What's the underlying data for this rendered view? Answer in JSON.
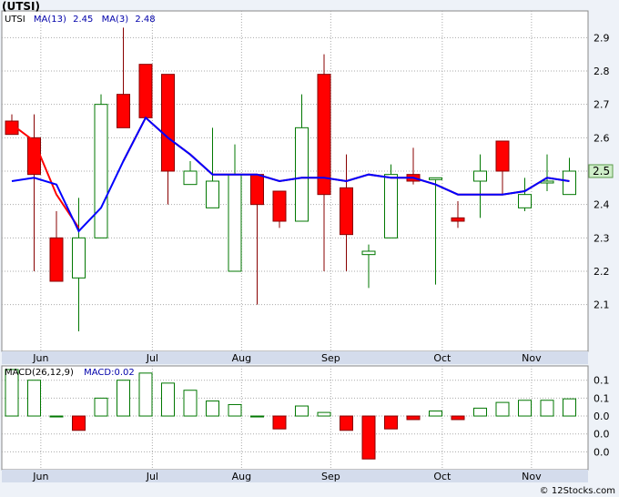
{
  "title": "(UTSI)",
  "watermark": "© 12Stocks.com",
  "colors": {
    "up_border": "#007700",
    "down_fill": "#ff0000",
    "ma13": "#ff0000",
    "ma3": "#0000ff",
    "grid": "#aaaaaa",
    "pane_bg": "#ffffff",
    "axis_bg": "#d4dcec",
    "price_highlight": "#cfeec9",
    "macd_label": "#0000aa"
  },
  "months": [
    {
      "label": "Jun",
      "x": 1.3
    },
    {
      "label": "Jul",
      "x": 6.3
    },
    {
      "label": "Aug",
      "x": 10.3
    },
    {
      "label": "Sep",
      "x": 14.3
    },
    {
      "label": "Oct",
      "x": 19.3
    },
    {
      "label": "Nov",
      "x": 23.3
    }
  ],
  "chart_data": [
    {
      "type": "candlestick",
      "legend": {
        "symbol": "UTSI",
        "ma13_label": "MA(13)",
        "ma13_value": "2.45",
        "ma3_label": "MA(3)",
        "ma3_value": "2.48"
      },
      "ylim": [
        1.96,
        2.98
      ],
      "yticks": [
        2.1,
        2.2,
        2.3,
        2.4,
        2.5,
        2.6,
        2.7,
        2.8,
        2.9
      ],
      "last_price": "2.5",
      "candles": [
        {
          "o": 2.65,
          "h": 2.67,
          "l": 2.61,
          "c": 2.61
        },
        {
          "o": 2.6,
          "h": 2.67,
          "l": 2.2,
          "c": 2.49
        },
        {
          "o": 2.3,
          "h": 2.38,
          "l": 2.17,
          "c": 2.17
        },
        {
          "o": 2.18,
          "h": 2.42,
          "l": 2.02,
          "c": 2.3
        },
        {
          "o": 2.3,
          "h": 2.73,
          "l": 2.3,
          "c": 2.7
        },
        {
          "o": 2.73,
          "h": 2.93,
          "l": 2.63,
          "c": 2.63
        },
        {
          "o": 2.82,
          "h": 2.82,
          "l": 2.66,
          "c": 2.66
        },
        {
          "o": 2.79,
          "h": 2.79,
          "l": 2.4,
          "c": 2.5
        },
        {
          "o": 2.46,
          "h": 2.53,
          "l": 2.46,
          "c": 2.5
        },
        {
          "o": 2.39,
          "h": 2.63,
          "l": 2.39,
          "c": 2.47
        },
        {
          "o": 2.2,
          "h": 2.58,
          "l": 2.2,
          "c": 2.49
        },
        {
          "o": 2.49,
          "h": 2.49,
          "l": 2.1,
          "c": 2.4
        },
        {
          "o": 2.44,
          "h": 2.44,
          "l": 2.33,
          "c": 2.35
        },
        {
          "o": 2.35,
          "h": 2.73,
          "l": 2.35,
          "c": 2.63
        },
        {
          "o": 2.79,
          "h": 2.85,
          "l": 2.2,
          "c": 2.43
        },
        {
          "o": 2.45,
          "h": 2.55,
          "l": 2.2,
          "c": 2.31
        },
        {
          "o": 2.25,
          "h": 2.28,
          "l": 2.15,
          "c": 2.26
        },
        {
          "o": 2.3,
          "h": 2.52,
          "l": 2.3,
          "c": 2.49
        },
        {
          "o": 2.49,
          "h": 2.57,
          "l": 2.46,
          "c": 2.47
        },
        {
          "o": 2.48,
          "h": 2.48,
          "l": 2.16,
          "c": 2.48
        },
        {
          "o": 2.36,
          "h": 2.41,
          "l": 2.33,
          "c": 2.35
        },
        {
          "o": 2.47,
          "h": 2.55,
          "l": 2.36,
          "c": 2.5
        },
        {
          "o": 2.59,
          "h": 2.59,
          "l": 2.43,
          "c": 2.5
        },
        {
          "o": 2.39,
          "h": 2.48,
          "l": 2.38,
          "c": 2.43
        },
        {
          "o": 2.47,
          "h": 2.55,
          "l": 2.44,
          "c": 2.47
        },
        {
          "o": 2.43,
          "h": 2.54,
          "l": 2.43,
          "c": 2.5
        }
      ],
      "ma13": [
        2.64,
        2.59,
        2.43,
        2.33,
        null,
        2.53,
        2.66,
        2.6,
        2.55,
        2.49,
        2.49,
        2.49,
        2.47,
        2.48,
        2.48,
        2.47,
        2.49,
        2.48,
        2.48,
        2.46,
        2.43,
        2.43,
        2.43,
        2.44,
        2.48,
        2.47
      ],
      "ma3": [
        2.47,
        2.48,
        2.46,
        2.32,
        2.39,
        2.53,
        2.66,
        2.6,
        2.55,
        2.49,
        2.49,
        2.49,
        2.47,
        2.48,
        2.48,
        2.47,
        2.49,
        2.48,
        2.48,
        2.46,
        2.43,
        2.43,
        2.43,
        2.44,
        2.48,
        2.47
      ]
    },
    {
      "type": "bar",
      "legend": {
        "label": "MACD(26,12,9)",
        "value_label": "MACD:0.02"
      },
      "ylim": [
        -0.075,
        0.07
      ],
      "ytick_values": [
        -0.05,
        -0.025,
        0.0,
        0.025,
        0.05
      ],
      "ytick_labels": [
        "0.0",
        "0.0",
        "0.0",
        "0.1",
        "0.1"
      ],
      "values": [
        0.065,
        0.05,
        0.0,
        -0.02,
        0.025,
        0.05,
        0.06,
        0.046,
        0.036,
        0.021,
        0.016,
        0.0,
        -0.018,
        0.014,
        0.005,
        -0.02,
        -0.06,
        -0.018,
        -0.005,
        0.007,
        -0.005,
        0.011,
        0.019,
        0.022,
        0.022,
        0.024
      ]
    }
  ]
}
